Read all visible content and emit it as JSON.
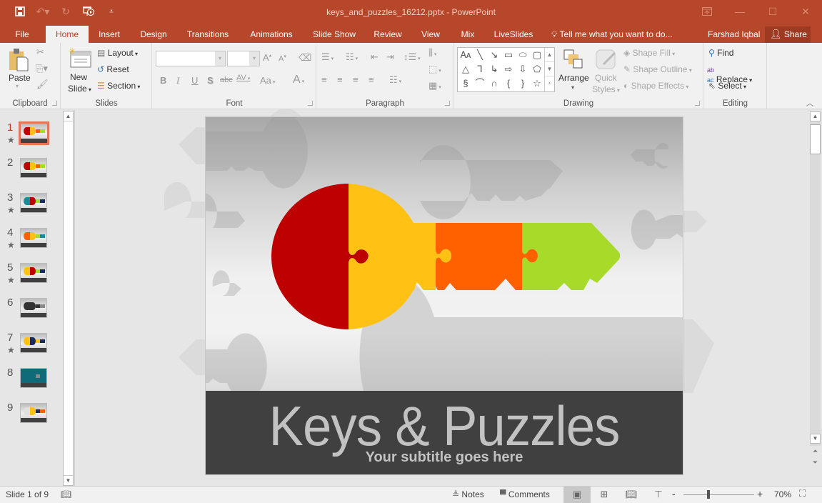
{
  "window": {
    "title": "keys_and_puzzles_16212.pptx - PowerPoint",
    "controls": [
      "ribbon-display-options",
      "minimize",
      "maximize",
      "close"
    ]
  },
  "qat": {
    "save": "save-icon",
    "undo": "undo-icon",
    "redo": "redo-icon",
    "present": "start-from-beginning-icon",
    "customize": "customize-qat-icon"
  },
  "tabs": [
    {
      "label": "File"
    },
    {
      "label": "Home",
      "active": true
    },
    {
      "label": "Insert"
    },
    {
      "label": "Design"
    },
    {
      "label": "Transitions"
    },
    {
      "label": "Animations"
    },
    {
      "label": "Slide Show"
    },
    {
      "label": "Review"
    },
    {
      "label": "View"
    },
    {
      "label": "Mix"
    },
    {
      "label": "LiveSlides"
    }
  ],
  "tellme": "Tell me what you want to do...",
  "user": "Farshad Iqbal",
  "share": "Share",
  "ribbon": {
    "clipboard": {
      "label": "Clipboard",
      "paste": "Paste"
    },
    "slides": {
      "label": "Slides",
      "new_slide_1": "New",
      "new_slide_2": "Slide",
      "layout": "Layout",
      "reset": "Reset",
      "section": "Section"
    },
    "font": {
      "label": "Font",
      "font_name": "",
      "font_size": "",
      "bold": "B",
      "italic": "I",
      "underline": "U",
      "shadow": "S",
      "strike": "abc",
      "spacing": "AV",
      "case": "Aa",
      "color": "A",
      "grow": "A",
      "shrink": "A"
    },
    "paragraph": {
      "label": "Paragraph"
    },
    "drawing": {
      "label": "Drawing",
      "arrange": "Arrange",
      "quick_styles_1": "Quick",
      "quick_styles_2": "Styles",
      "shape_fill": "Shape Fill",
      "shape_outline": "Shape Outline",
      "shape_effects": "Shape Effects"
    },
    "editing": {
      "label": "Editing",
      "find": "Find",
      "replace": "Replace",
      "select": "Select"
    }
  },
  "thumbnails": [
    {
      "num": "1",
      "star": true,
      "active": true
    },
    {
      "num": "2",
      "star": false
    },
    {
      "num": "3",
      "star": true
    },
    {
      "num": "4",
      "star": true
    },
    {
      "num": "5",
      "star": true
    },
    {
      "num": "6",
      "star": false
    },
    {
      "num": "7",
      "star": true
    },
    {
      "num": "8",
      "star": false
    },
    {
      "num": "9",
      "star": false
    }
  ],
  "slide": {
    "title": "Keys & Puzzles",
    "subtitle": "Your subtitle goes here",
    "colors": {
      "red": "#bd0000",
      "yellow": "#ffc214",
      "orange": "#ff6000",
      "green": "#a8db29",
      "band": "#404040"
    }
  },
  "status": {
    "slide_info": "Slide 1 of 9",
    "notes": "Notes",
    "comments": "Comments",
    "zoom": "70%"
  },
  "theme": {
    "accent": "#b7472a"
  }
}
